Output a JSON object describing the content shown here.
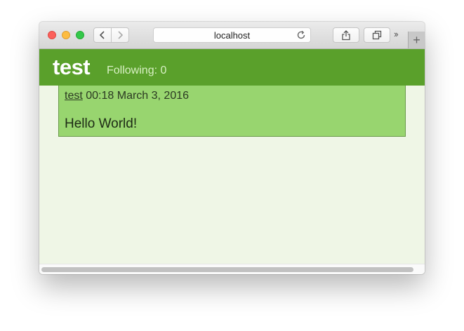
{
  "browser": {
    "url": "localhost",
    "icons": {
      "back": "chevron-left-icon",
      "forward": "chevron-right-icon",
      "reload": "reload-icon",
      "share": "share-icon",
      "tabs": "tabs-overview-icon",
      "overflow": "double-chevron-icon",
      "new_tab": "plus-icon"
    },
    "overflow_glyph": "››",
    "new_tab_glyph": "+"
  },
  "header": {
    "title": "test",
    "following": "Following: 0"
  },
  "posts": [
    {
      "author": "test",
      "timestamp": "00:18 March 3, 2016",
      "body": "Hello World!"
    }
  ],
  "colors": {
    "header_bg": "#5aa02b",
    "post_bg": "#98d56f",
    "page_bg": "#eff6e6"
  }
}
